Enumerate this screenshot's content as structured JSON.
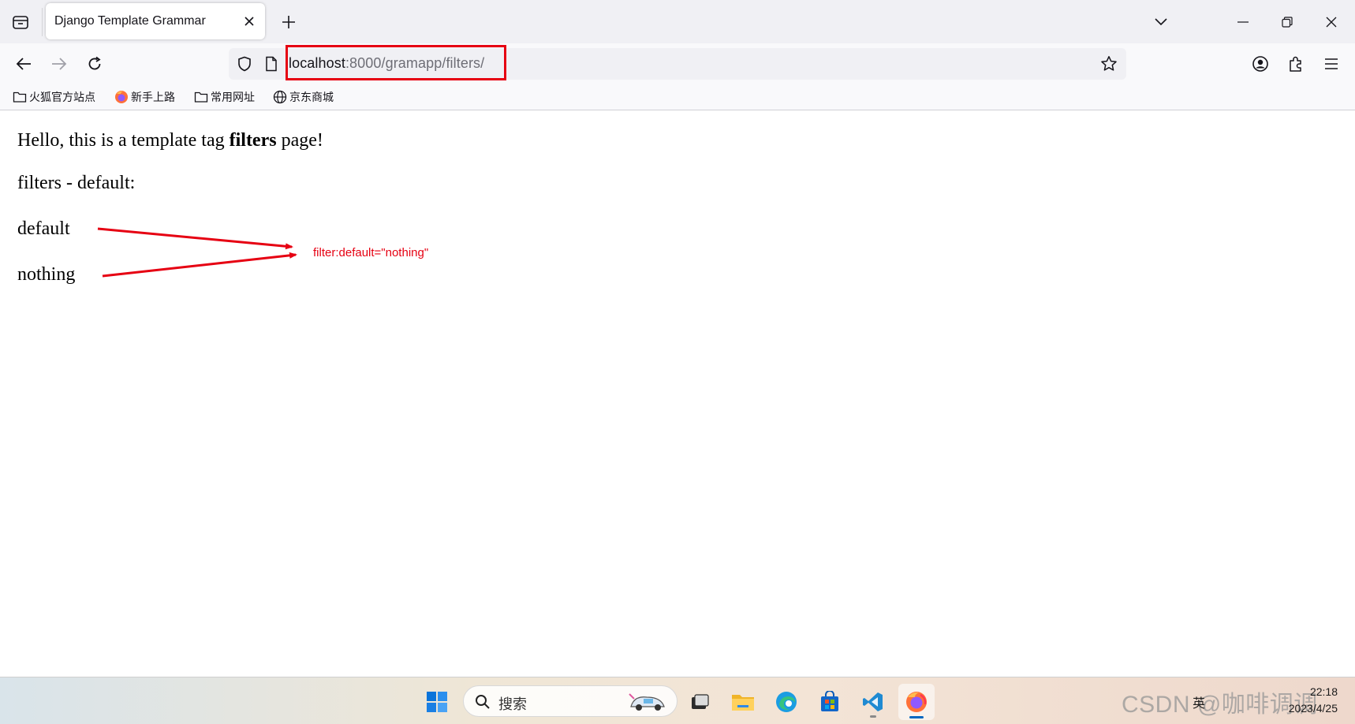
{
  "browser": {
    "tab": {
      "title": "Django Template Grammar"
    },
    "url": {
      "host": "localhost",
      "rest": ":8000/gramapp/filters/"
    },
    "bookmarks": [
      {
        "label": "火狐官方站点",
        "icon": "folder-icon"
      },
      {
        "label": "新手上路",
        "icon": "firefox-icon"
      },
      {
        "label": "常用网址",
        "icon": "folder-icon"
      },
      {
        "label": "京东商城",
        "icon": "globe-icon"
      }
    ]
  },
  "page": {
    "line1": {
      "before": "Hello, this is a template tag ",
      "bold": "filters",
      "after": " page!"
    },
    "line2": "filters - default:",
    "line3": "default",
    "line4": "nothing"
  },
  "annotation": {
    "label": "filter:default=\"nothing\"",
    "color": "#e60012"
  },
  "taskbar": {
    "search_label": "搜索",
    "tray_lang": "英",
    "watermark": "CSDN @咖啡调调",
    "clock_time": "22:18",
    "clock_date": "2023/4/25"
  },
  "colors": {
    "accent": "#0067c0",
    "highlight": "#e60012"
  }
}
